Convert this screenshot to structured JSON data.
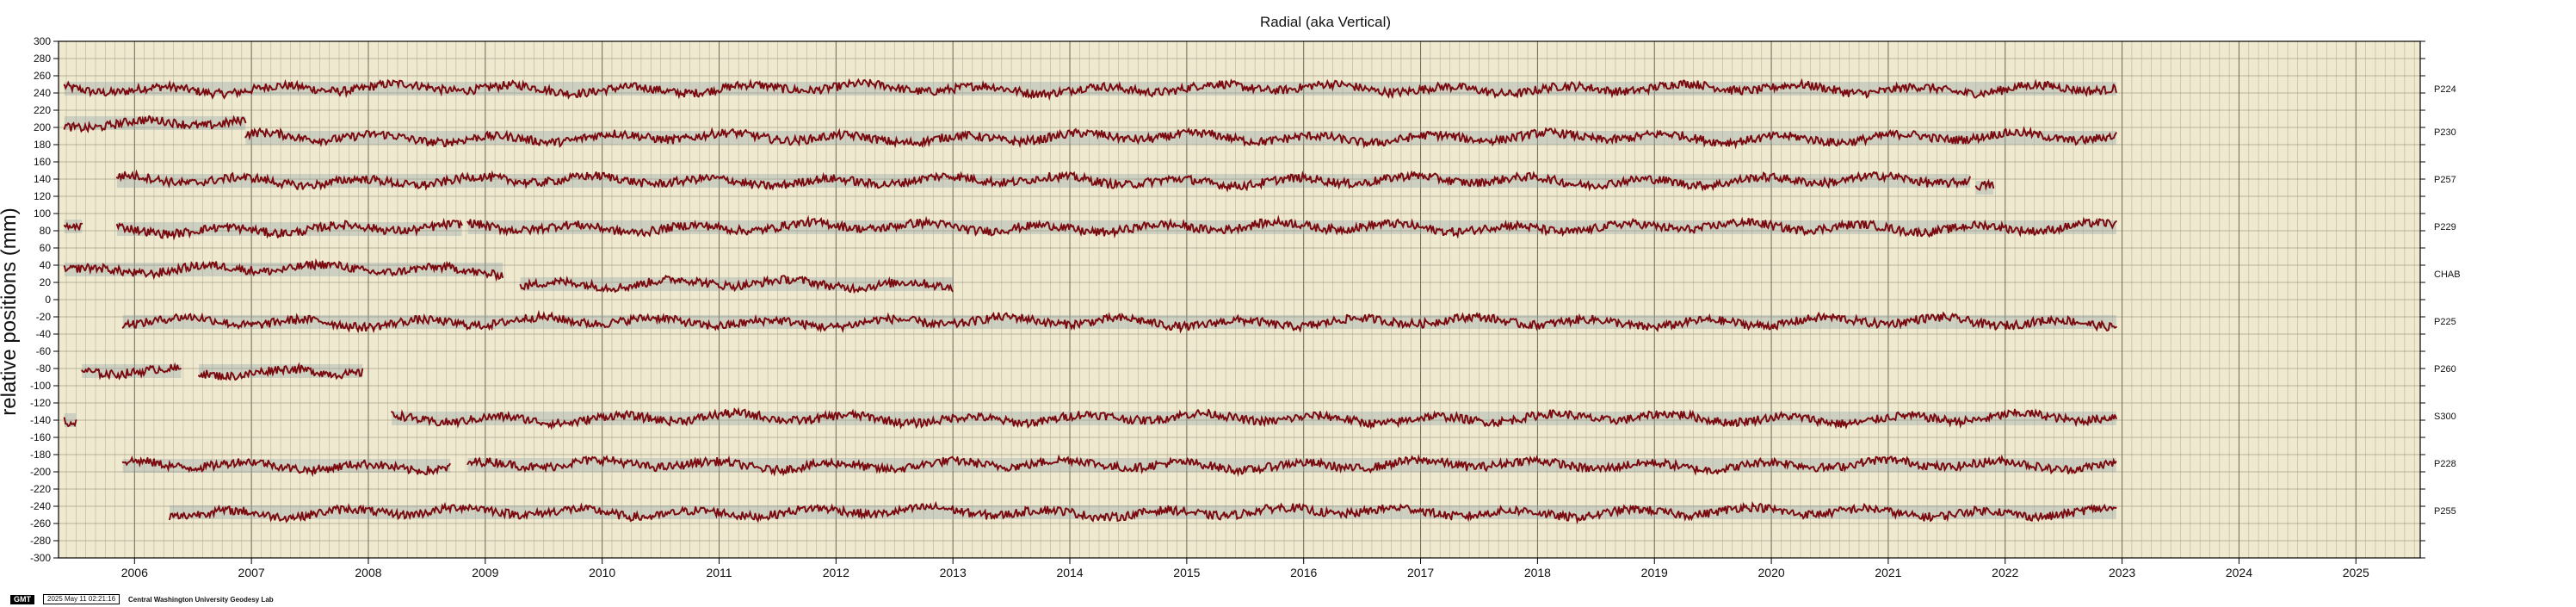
{
  "chart_data": {
    "type": "scatter",
    "title": "Radial (aka Vertical)",
    "xlabel": "",
    "ylabel": "relative positions (mm)",
    "xlim": [
      2005.35,
      2025.55
    ],
    "ylim": [
      -300,
      300
    ],
    "y_ticks": [
      300,
      280,
      260,
      240,
      220,
      200,
      180,
      160,
      140,
      120,
      100,
      80,
      60,
      40,
      20,
      0,
      -20,
      -40,
      -60,
      -80,
      -100,
      -120,
      -140,
      -160,
      -180,
      -200,
      -220,
      -240,
      -260,
      -280,
      -300
    ],
    "x_ticks": [
      2006,
      2007,
      2008,
      2009,
      2010,
      2011,
      2012,
      2013,
      2014,
      2015,
      2016,
      2017,
      2018,
      2019,
      2020,
      2021,
      2022,
      2023,
      2024,
      2025
    ],
    "grid": true,
    "background_color": "#efe9d0",
    "point_color": "#7a0a10",
    "band_color": "#8fa3a3",
    "series": [
      {
        "name": "P224",
        "label_offset": 245,
        "segments": [
          {
            "x": [
              2005.4,
              2022.95
            ],
            "y": 245
          }
        ]
      },
      {
        "name": "P230",
        "label_offset": 195,
        "segments": [
          {
            "x": [
              2005.4,
              2006.95
            ],
            "y": 205
          },
          {
            "x": [
              2006.95,
              2022.95
            ],
            "y": 188
          }
        ]
      },
      {
        "name": "P257",
        "label_offset": 140,
        "segments": [
          {
            "x": [
              2005.85,
              2021.7
            ],
            "y": 138
          },
          {
            "x": [
              2021.75,
              2021.9
            ],
            "y": 130
          }
        ]
      },
      {
        "name": "P229",
        "label_offset": 85,
        "segments": [
          {
            "x": [
              2005.4,
              2005.55
            ],
            "y": 85
          },
          {
            "x": [
              2005.85,
              2008.8
            ],
            "y": 82
          },
          {
            "x": [
              2008.85,
              2022.95
            ],
            "y": 84
          }
        ]
      },
      {
        "name": "CHAB",
        "label_offset": 30,
        "segments": [
          {
            "x": [
              2005.4,
              2009.15
            ],
            "y": 35
          },
          {
            "x": [
              2009.3,
              2013.0
            ],
            "y": 18
          }
        ]
      },
      {
        "name": "P225",
        "label_offset": -25,
        "segments": [
          {
            "x": [
              2005.9,
              2022.95
            ],
            "y": -26
          }
        ]
      },
      {
        "name": "P260",
        "label_offset": -80,
        "segments": [
          {
            "x": [
              2005.55,
              2006.4
            ],
            "y": -83
          },
          {
            "x": [
              2006.55,
              2007.95
            ],
            "y": -83
          }
        ]
      },
      {
        "name": "S300",
        "label_offset": -135,
        "segments": [
          {
            "x": [
              2005.4,
              2005.5
            ],
            "y": -140
          },
          {
            "x": [
              2008.2,
              2022.95
            ],
            "y": -138
          }
        ]
      },
      {
        "name": "P228",
        "label_offset": -190,
        "segments": [
          {
            "x": [
              2005.9,
              2008.7
            ],
            "y": -193
          },
          {
            "x": [
              2008.85,
              2022.95
            ],
            "y": -192
          }
        ]
      },
      {
        "name": "P255",
        "label_offset": -245,
        "segments": [
          {
            "x": [
              2006.3,
              2022.95
            ],
            "y": -247
          }
        ]
      }
    ]
  },
  "footer": {
    "logo": "GMT",
    "timestamp": "2025 May 11 02:21:16",
    "credit": "Central Washington University Geodesy Lab"
  }
}
